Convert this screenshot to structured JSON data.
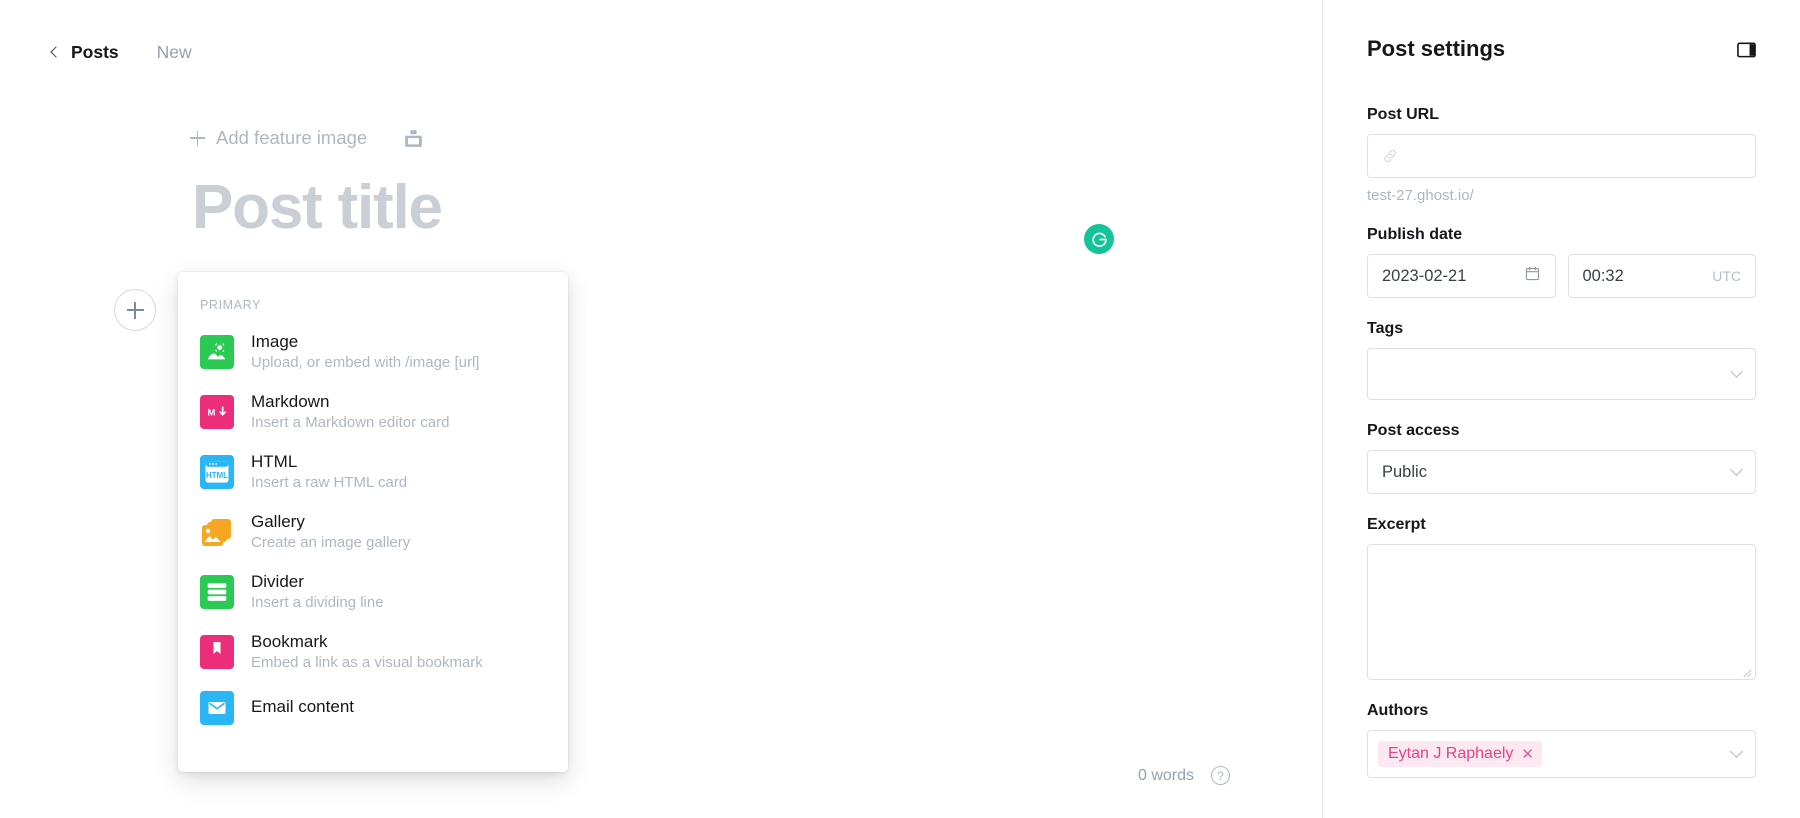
{
  "breadcrumb": {
    "back_label": "Posts",
    "current_label": "New",
    "back_icon": "chevron-left-icon"
  },
  "editor": {
    "feature_image_label": "Add feature image",
    "feature_image_plus_icon": "plus-icon",
    "unsplash_icon": "unsplash-icon",
    "post_title_placeholder": "Post title",
    "grammarly_icon": "grammarly-icon",
    "grammarly_color": "#15c39a",
    "add_card_button_icon": "plus-circle-icon",
    "word_count": "0 words",
    "help_icon": "question-mark-icon"
  },
  "card_menu": {
    "section_title": "PRIMARY",
    "items": [
      {
        "title": "Image",
        "description": "Upload, or embed with /image [url]",
        "icon": "image-card-icon",
        "color": "#2bca54"
      },
      {
        "title": "Markdown",
        "description": "Insert a Markdown editor card",
        "icon": "markdown-card-icon",
        "color": "#ec2d79"
      },
      {
        "title": "HTML",
        "description": "Insert a raw HTML card",
        "icon": "html-card-icon",
        "color": "#29b6f2"
      },
      {
        "title": "Gallery",
        "description": "Create an image gallery",
        "icon": "gallery-card-icon",
        "color": "#f5a623"
      },
      {
        "title": "Divider",
        "description": "Insert a dividing line",
        "icon": "divider-card-icon",
        "color": "#2bca54"
      },
      {
        "title": "Bookmark",
        "description": "Embed a link as a visual bookmark",
        "icon": "bookmark-card-icon",
        "color": "#ec2d79"
      },
      {
        "title": "Email content",
        "description": "",
        "icon": "email-card-icon",
        "color": "#29b6f2"
      }
    ]
  },
  "sidebar": {
    "title": "Post settings",
    "toggle_icon": "panel-toggle-icon",
    "post_url": {
      "label": "Post URL",
      "value": "",
      "icon": "link-icon",
      "hint": "test-27.ghost.io/"
    },
    "publish_date": {
      "label": "Publish date",
      "date_value": "2023-02-21",
      "date_icon": "calendar-icon",
      "time_value": "00:32",
      "timezone": "UTC"
    },
    "tags": {
      "label": "Tags",
      "value": "",
      "chevron_icon": "chevron-down-icon"
    },
    "post_access": {
      "label": "Post access",
      "value": "Public",
      "chevron_icon": "chevron-down-icon",
      "options": [
        "Public"
      ]
    },
    "excerpt": {
      "label": "Excerpt",
      "value": "",
      "resize_icon": "resize-grip-icon"
    },
    "authors": {
      "label": "Authors",
      "chips": [
        {
          "name": "Eytan J Raphaely",
          "remove_icon": "close-icon"
        }
      ],
      "chevron_icon": "chevron-down-icon",
      "chip_bg": "#fce8f0",
      "chip_fg": "#e0468a"
    }
  }
}
